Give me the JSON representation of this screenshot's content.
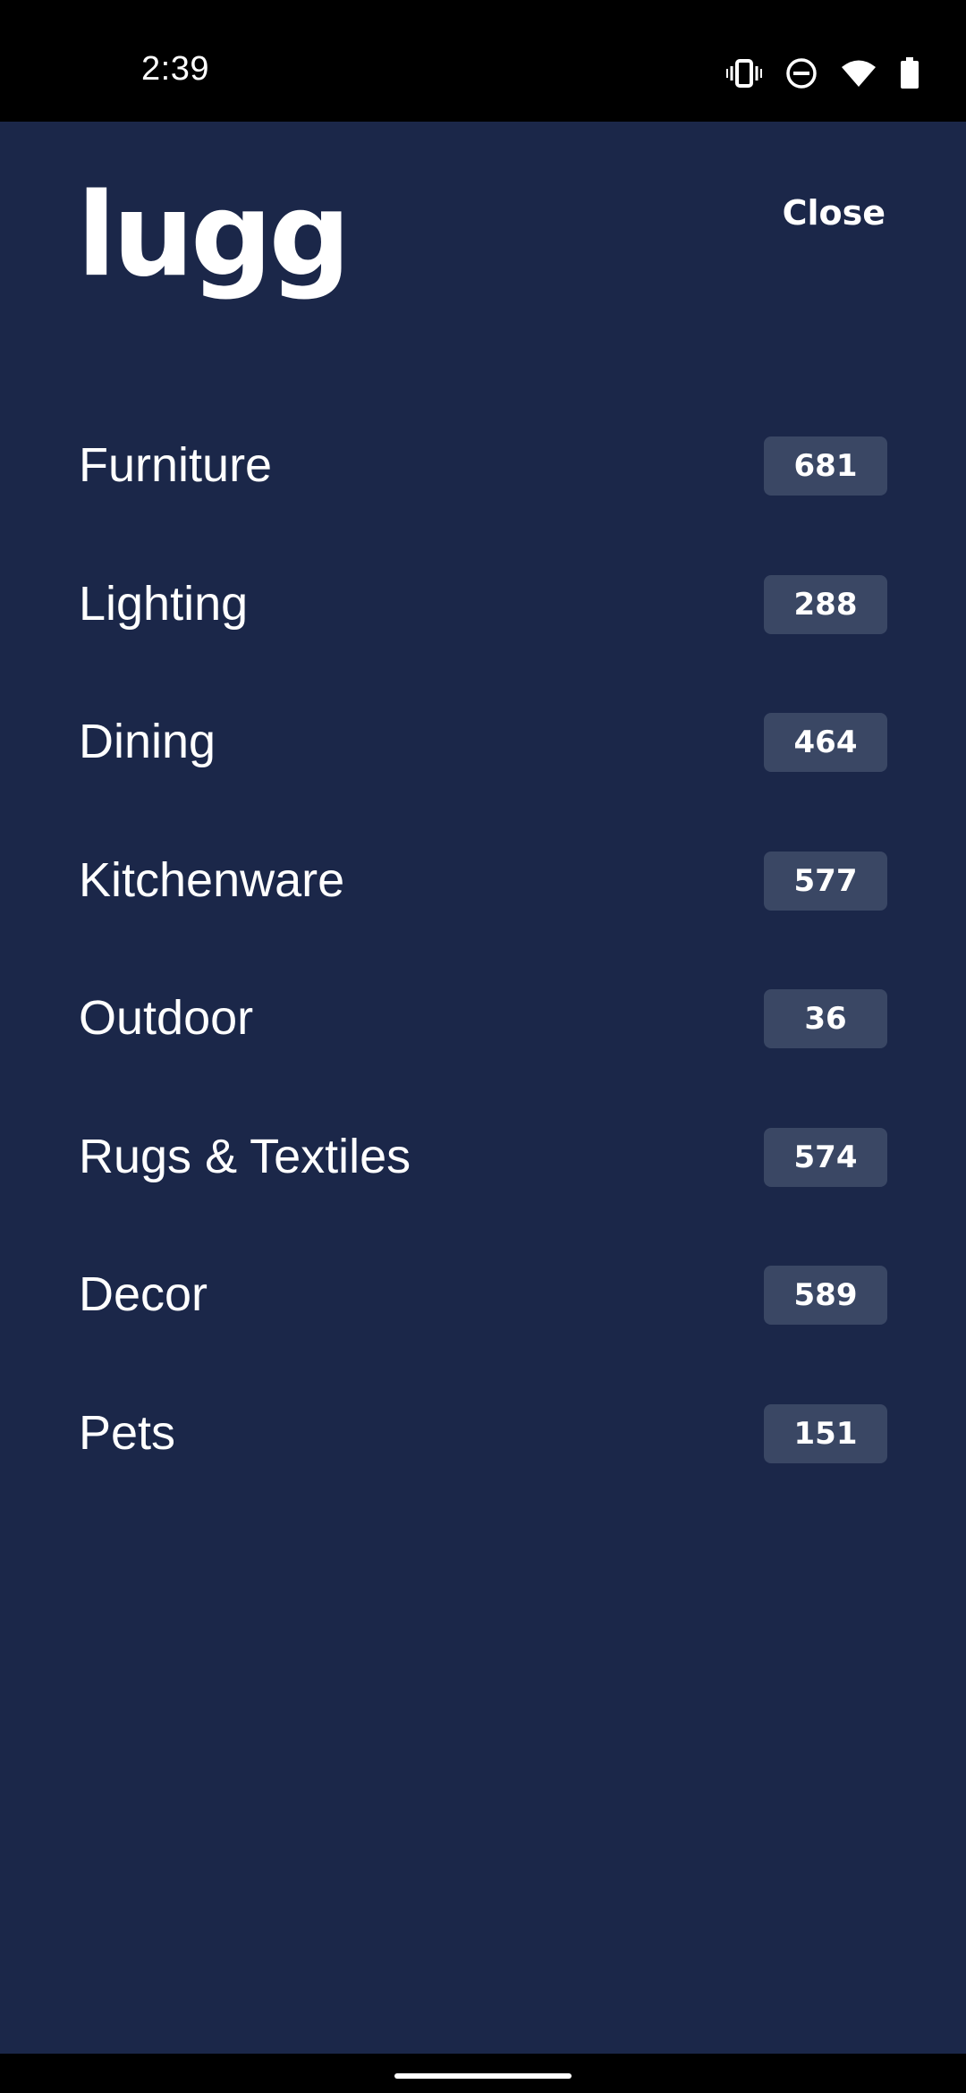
{
  "status_bar": {
    "time": "2:39",
    "icons": [
      "vibrate-icon",
      "do-not-disturb-icon",
      "wifi-icon",
      "battery-icon"
    ]
  },
  "header": {
    "logo": "lugg",
    "close_label": "Close"
  },
  "categories": [
    {
      "label": "Furniture",
      "count": "681"
    },
    {
      "label": "Lighting",
      "count": "288"
    },
    {
      "label": "Dining",
      "count": "464"
    },
    {
      "label": "Kitchenware",
      "count": "577"
    },
    {
      "label": "Outdoor",
      "count": "36"
    },
    {
      "label": "Rugs & Textiles",
      "count": "574"
    },
    {
      "label": "Decor",
      "count": "589"
    },
    {
      "label": "Pets",
      "count": "151"
    }
  ],
  "colors": {
    "background": "#1b2749",
    "badge": "#3a4764",
    "text": "#ffffff",
    "system_bars": "#000000"
  }
}
